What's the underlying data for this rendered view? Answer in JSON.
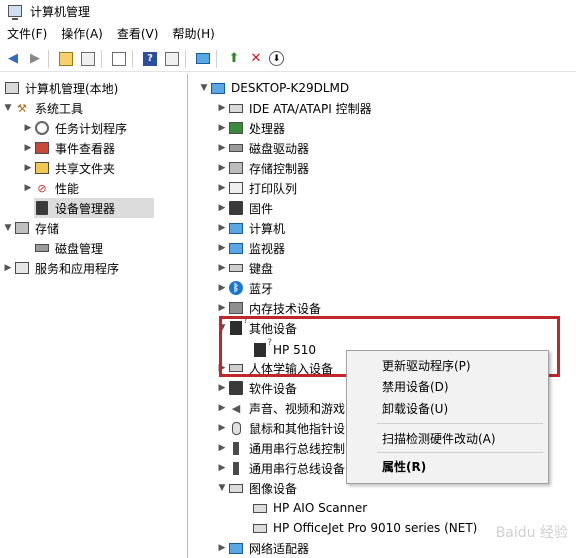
{
  "window": {
    "title": "计算机管理"
  },
  "menu": [
    "文件(F)",
    "操作(A)",
    "查看(V)",
    "帮助(H)"
  ],
  "left_tree": {
    "root": "计算机管理(本地)",
    "system_tools": "系统工具",
    "task_scheduler": "任务计划程序",
    "event_viewer": "事件查看器",
    "shared_folders": "共享文件夹",
    "performance": "性能",
    "device_manager": "设备管理器",
    "storage": "存储",
    "disk_management": "磁盘管理",
    "services_apps": "服务和应用程序"
  },
  "right_tree": {
    "computer": "DESKTOP-K29DLMD",
    "ide": "IDE ATA/ATAPI 控制器",
    "processor": "处理器",
    "disk_drives": "磁盘驱动器",
    "storage_controllers": "存储控制器",
    "print_queue": "打印队列",
    "firmware": "固件",
    "computer_node": "计算机",
    "monitors": "监视器",
    "keyboard": "键盘",
    "bluetooth": "蓝牙",
    "memory_tech": "内存技术设备",
    "other_devices": "其他设备",
    "hp510": "HP 510",
    "hid": "人体学输入设备",
    "software_devices": "软件设备",
    "audio": "声音、视频和游戏",
    "mice": "鼠标和其他指针设",
    "usb1": "通用串行总线控制",
    "usb2": "通用串行总线设备",
    "imaging": "图像设备",
    "hp_aio": "HP AIO Scanner",
    "hp_officejet": "HP OfficeJet Pro 9010 series (NET)",
    "network": "网络适配器"
  },
  "context_menu": {
    "update_driver": "更新驱动程序(P)",
    "disable": "禁用设备(D)",
    "uninstall": "卸载设备(U)",
    "scan": "扫描检测硬件改动(A)",
    "properties": "属性(R)"
  },
  "watermark": "Baidu 经验"
}
